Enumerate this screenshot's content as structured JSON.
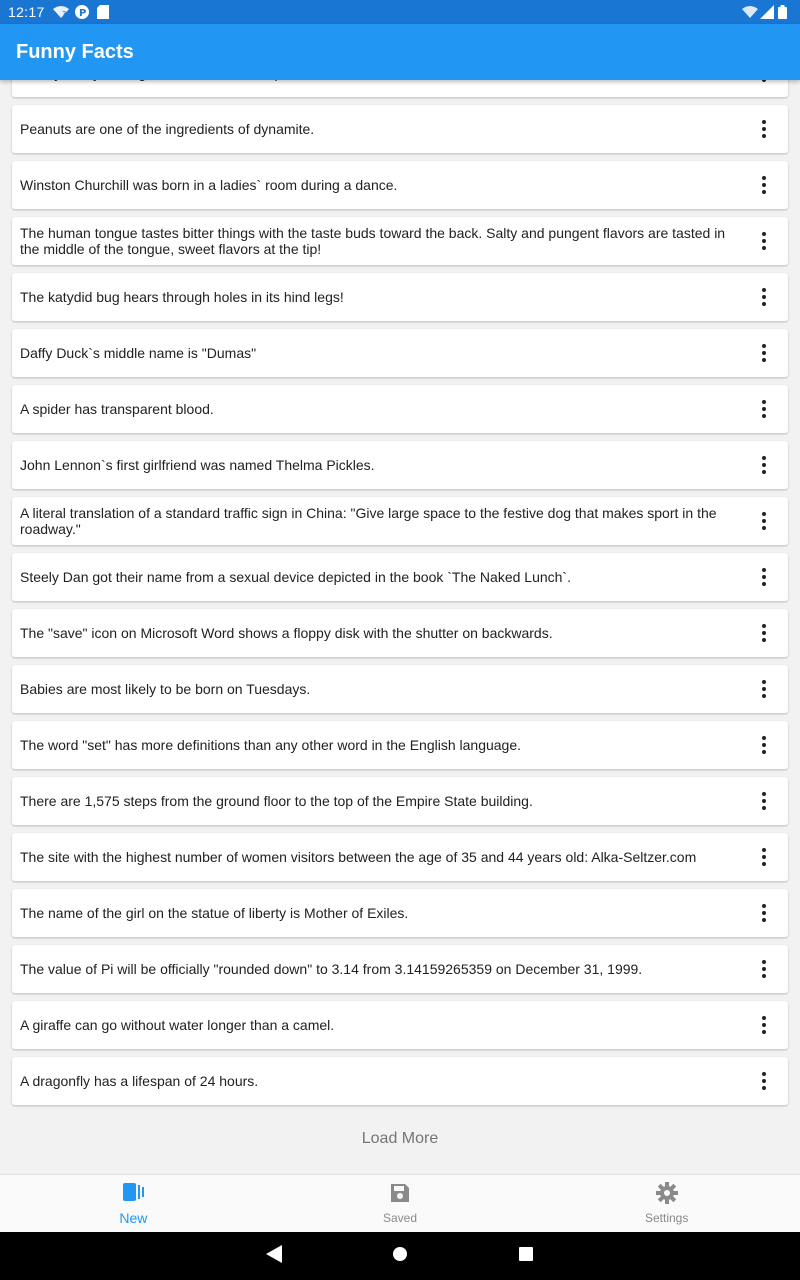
{
  "status_bar": {
    "time": "12:17",
    "icons_left": [
      "wifi-question-icon",
      "p-app-icon",
      "sd-card-icon"
    ],
    "icons_right": [
      "wifi-icon",
      "signal-icon",
      "battery-icon"
    ]
  },
  "app_bar": {
    "title": "Funny Facts"
  },
  "facts": [
    "each year by adding most of the month April to D.S.T.",
    "Peanuts are one of the ingredients of dynamite.",
    "Winston Churchill was born in a ladies` room during a dance.",
    "The human tongue tastes bitter things with the taste buds toward the back. Salty and pungent flavors are tasted in the middle of the tongue, sweet flavors at the tip!",
    "The katydid bug hears through holes in its hind legs!",
    "Daffy Duck`s middle name is \"Dumas\"",
    "A spider has transparent blood.",
    "John Lennon`s first girlfriend was named Thelma Pickles.",
    "A literal translation of a standard traffic sign in China: \"Give large space to the festive dog that makes sport in the roadway.\"",
    "Steely Dan got their name from a sexual device depicted in the book `The Naked Lunch`.",
    "The \"save\" icon on Microsoft Word shows a floppy disk with the shutter on backwards.",
    "Babies are most likely to be born on Tuesdays.",
    "The word \"set\" has more definitions than any other word in the English language.",
    "There are 1,575 steps from the ground floor to the top of the Empire State building.",
    "The site with the highest number of women visitors between the age of 35 and 44 years old: Alka-Seltzer.com",
    "The name of the girl on the statue of liberty is Mother of Exiles.",
    "The value of Pi will be officially \"rounded down\" to 3.14 from 3.14159265359 on December 31, 1999.",
    "A giraffe can go without water longer than a camel.",
    "A dragonfly has a lifespan of 24 hours."
  ],
  "load_more": "Load More",
  "bottom_nav": {
    "items": [
      {
        "label": "New",
        "icon": "book-icon",
        "active": true
      },
      {
        "label": "Saved",
        "icon": "save-icon",
        "active": false
      },
      {
        "label": "Settings",
        "icon": "gear-icon",
        "active": false
      }
    ]
  },
  "colors": {
    "primary": "#2196f3",
    "status_bar": "#1976d2"
  }
}
